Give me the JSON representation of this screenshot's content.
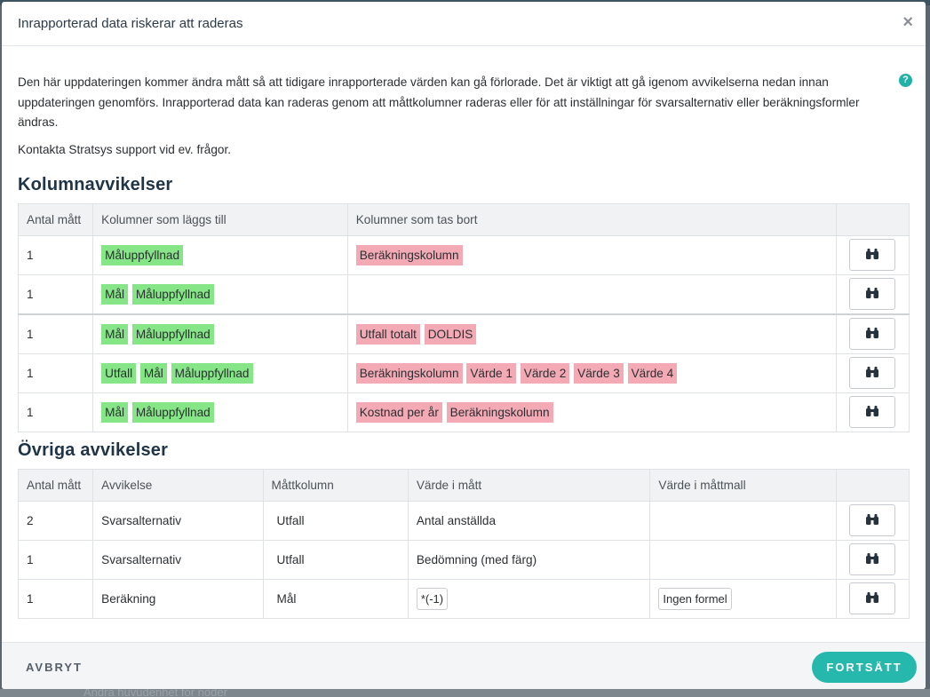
{
  "background": {
    "footer_peek_text": "Ändra huvudenhet för noder"
  },
  "dialog": {
    "title": "Inrapporterad data riskerar att raderas",
    "close_label": "×",
    "help_label": "?",
    "intro": "Den här uppdateringen kommer ändra mått så att tidigare inrapporterade värden kan gå förlorade. Det är viktigt att gå igenom avvikelserna nedan innan uppdateringen genomförs. Inrapporterad data kan raderas genom att måttkolumner raderas eller för att inställningar för svarsalternativ eller beräkningsformler ändras.",
    "contact": "Kontakta Stratsys support vid ev. frågor."
  },
  "kolumn": {
    "heading": "Kolumnavvikelser",
    "headers": [
      "Antal mått",
      "Kolumner som läggs till",
      "Kolumner som tas bort",
      ""
    ],
    "rows": [
      {
        "count": "1",
        "added": [
          "Måluppfyllnad"
        ],
        "removed": [
          "Beräkningskolumn"
        ]
      },
      {
        "count": "1",
        "added": [
          "Mål",
          "Måluppfyllnad"
        ],
        "removed": []
      },
      {
        "count": "1",
        "added": [
          "Mål",
          "Måluppfyllnad"
        ],
        "removed": [
          "Utfall totalt",
          "DOLDIS"
        ]
      },
      {
        "count": "1",
        "added": [
          "Utfall",
          "Mål",
          "Måluppfyllnad"
        ],
        "removed": [
          "Beräkningskolumn",
          "Värde 1",
          "Värde 2",
          "Värde 3",
          "Värde 4"
        ]
      },
      {
        "count": "1",
        "added": [
          "Mål",
          "Måluppfyllnad"
        ],
        "removed": [
          "Kostnad per år",
          "Beräkningskolumn"
        ]
      }
    ]
  },
  "ovriga": {
    "heading": "Övriga avvikelser",
    "headers": [
      "Antal mått",
      "Avvikelse",
      "Måttkolumn",
      "Värde i mått",
      "Värde i måttmall",
      ""
    ],
    "rows": [
      {
        "count": "2",
        "deviation": "Svarsalternativ",
        "column": "Utfall",
        "value": "Antal anställda",
        "value_chip": false,
        "template": "",
        "template_chip": false
      },
      {
        "count": "1",
        "deviation": "Svarsalternativ",
        "column": "Utfall",
        "value": "Bedömning (med färg)",
        "value_chip": false,
        "template": "",
        "template_chip": false
      },
      {
        "count": "1",
        "deviation": "Beräkning",
        "column": "Mål",
        "value": "*(-1)",
        "value_chip": true,
        "template": "Ingen formel",
        "template_chip": true
      }
    ]
  },
  "footer": {
    "cancel_label": "AVBRYT",
    "continue_label": "FORTSÄTT"
  },
  "icons": {
    "inspect": "binoculars-icon",
    "help": "help-circle-icon",
    "close": "close-icon"
  },
  "colors": {
    "added_tag": "#86e586",
    "removed_tag": "#f4aab5",
    "accent": "#27b8ad"
  }
}
